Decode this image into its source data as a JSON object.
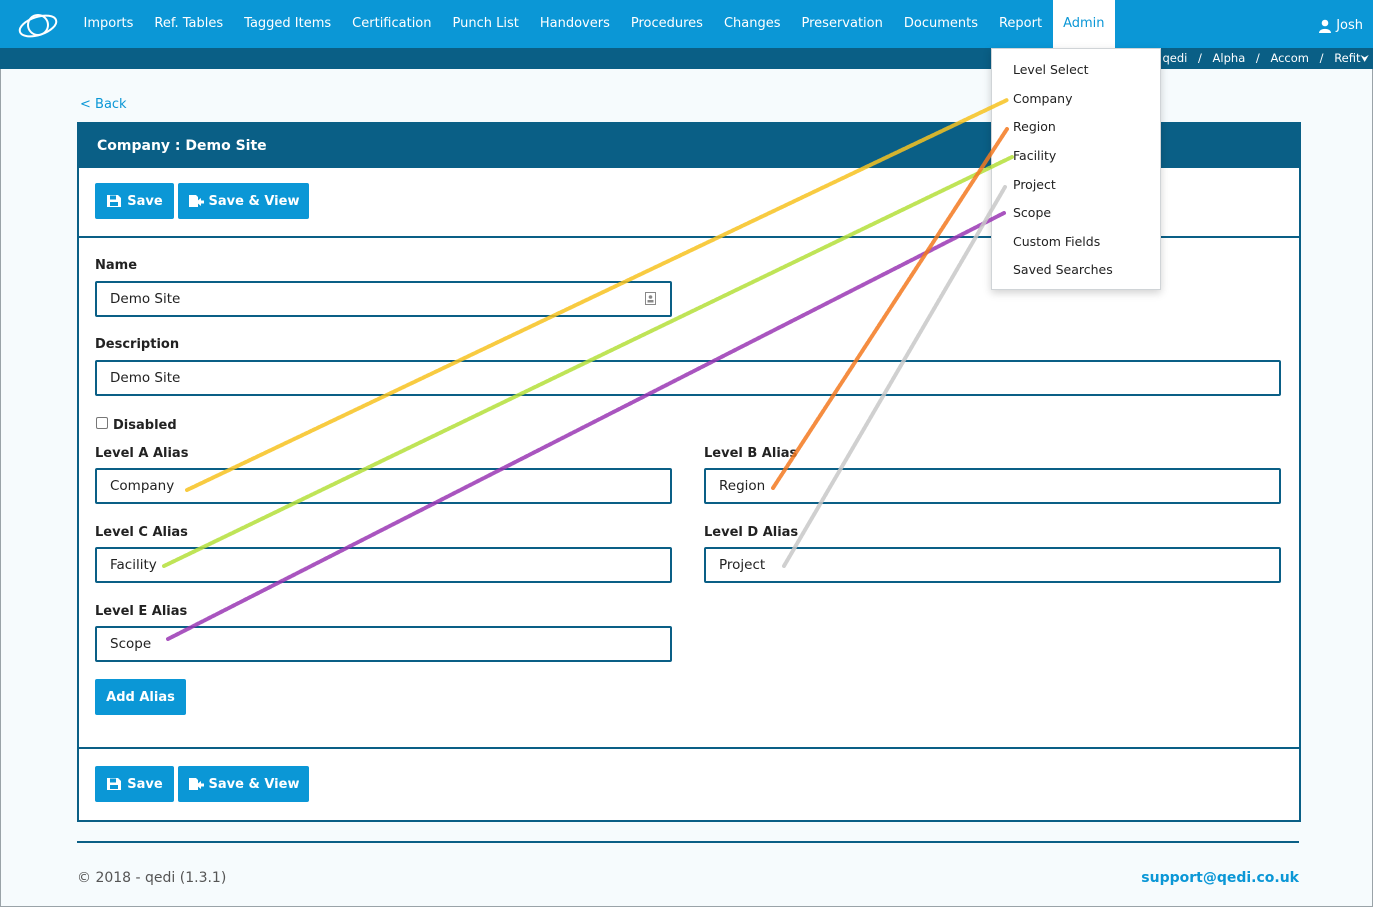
{
  "nav": {
    "items": [
      "Imports",
      "Ref. Tables",
      "Tagged Items",
      "Certification",
      "Punch List",
      "Handovers",
      "Procedures",
      "Changes",
      "Preservation",
      "Documents",
      "Report",
      "Admin"
    ],
    "active": "Admin",
    "user": "Josh"
  },
  "breadcrumb": {
    "items": [
      "qedi",
      "Alpha",
      "Accom",
      "Refit"
    ]
  },
  "back_label": "< Back",
  "card": {
    "title": "Company : Demo Site",
    "save_label": "Save",
    "save_view_label": "Save & View",
    "name_label": "Name",
    "name_value": "Demo Site",
    "description_label": "Description",
    "description_value": "Demo Site",
    "disabled_label": "Disabled",
    "disabled_checked": false,
    "level_a_label": "Level A Alias",
    "level_a_value": "Company",
    "level_b_label": "Level B Alias",
    "level_b_value": "Region",
    "level_c_label": "Level C Alias",
    "level_c_value": "Facility",
    "level_d_label": "Level D Alias",
    "level_d_value": "Project",
    "level_e_label": "Level E Alias",
    "level_e_value": "Scope",
    "add_alias_label": "Add Alias"
  },
  "dropdown": {
    "items": [
      "Level Select",
      "Company",
      "Region",
      "Facility",
      "Project",
      "Scope",
      "Custom Fields",
      "Saved Searches"
    ]
  },
  "footer": {
    "copyright": "© 2018 - qedi (1.3.1)",
    "support": "support@qedi.co.uk"
  },
  "colors": {
    "primary": "#0b97d6",
    "dark": "#0a5f86",
    "annotation_company": "#f7c320",
    "annotation_region": "#f47a20",
    "annotation_facility": "#b5e03a",
    "annotation_project": "#c8c8c8",
    "annotation_scope": "#9b38b5"
  }
}
